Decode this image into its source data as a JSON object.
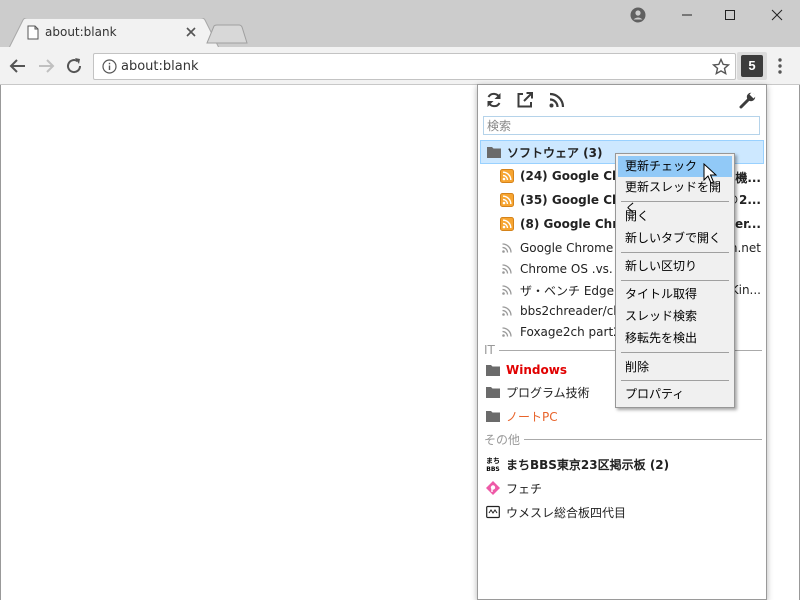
{
  "browser": {
    "tab_title": "about:blank",
    "url": "about:blank",
    "extension_badge": "5"
  },
  "popup": {
    "search_placeholder": "検索",
    "folder_software": {
      "label": "ソフトウェア (3)"
    },
    "feeds": [
      {
        "label": "(24) Google Chro",
        "right": "機...",
        "unread": true
      },
      {
        "label": "(35) Google Chro",
        "right": "©2...",
        "unread": true
      },
      {
        "label": "(8) Google Chron",
        "right": "per...",
        "unread": true
      },
      {
        "label": "Google Chrome V",
        "right": "n.net",
        "unread": false
      },
      {
        "label": "Chrome OS .vs. C",
        "right": "",
        "unread": false
      },
      {
        "label": "ザ・ベンチ Edge I",
        "right": "Kin...",
        "unread": false
      },
      {
        "label": "bbs2chreader/cha",
        "right": "",
        "unread": false
      },
      {
        "label": "Foxage2ch part2",
        "right": "",
        "unread": false
      }
    ],
    "section_it": "IT",
    "it_items": [
      {
        "label": "Windows",
        "color": "#e10000"
      },
      {
        "label": "プログラム技術",
        "color": "#222222"
      },
      {
        "label": "ノートPC",
        "color": "#e8632a"
      }
    ],
    "section_other": "その他",
    "other_items": [
      {
        "label": "まちBBS東京23区掲示板 (2)",
        "icon": "machi-bbs-icon"
      },
      {
        "label": "フェチ",
        "icon": "pink-diamond-icon"
      },
      {
        "label": "ウメスレ総合板四代目",
        "icon": "board-icon"
      }
    ]
  },
  "context_menu": {
    "items": [
      "更新チェック",
      "更新スレッドを開く",
      "開く",
      "新しいタブで開く",
      "新しい区切り",
      "タイトル取得",
      "スレッド検索",
      "移転先を検出",
      "削除",
      "プロパティ"
    ],
    "hovered": "更新チェック"
  },
  "colors": {
    "selection": "#cde8ff",
    "menu_hover": "#91c9f7",
    "rss_orange": "#f7a531"
  }
}
